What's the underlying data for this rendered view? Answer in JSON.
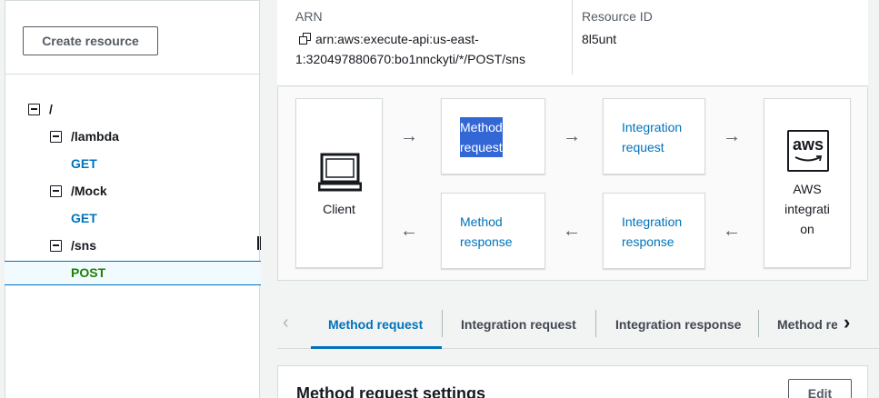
{
  "sidebar": {
    "create_button": "Create resource",
    "tree": [
      {
        "label": "/",
        "kind": "resource"
      },
      {
        "label": "/lambda",
        "kind": "resource"
      },
      {
        "label": "GET",
        "kind": "method"
      },
      {
        "label": "/Mock",
        "kind": "resource"
      },
      {
        "label": "GET",
        "kind": "method"
      },
      {
        "label": "/sns",
        "kind": "resource"
      },
      {
        "label": "POST",
        "kind": "method",
        "selected": true
      }
    ]
  },
  "info": {
    "arn_label": "ARN",
    "arn_line1": "arn:aws:execute-api:us-east-",
    "arn_line2": "1:320497880670:bo1nnckyti/*/POST/sns",
    "resource_id_label": "Resource ID",
    "resource_id_value": "8l5unt"
  },
  "flow": {
    "client": "Client",
    "method_request_1": "Method",
    "method_request_2": "request",
    "integration_request_1": "Integration",
    "integration_request_2": "request",
    "method_response_1": "Method",
    "method_response_2": "response",
    "integration_response_1": "Integration",
    "integration_response_2": "response",
    "aws_logo": "aws",
    "aws_integration_1": "AWS",
    "aws_integration_2": "integrati",
    "aws_integration_3": "on"
  },
  "tabs": {
    "items": [
      "Method request",
      "Integration request",
      "Integration response",
      "Method re"
    ],
    "active": "Method request"
  },
  "settings": {
    "title": "Method request settings",
    "edit": "Edit"
  },
  "colors": {
    "link": "#0073bb",
    "post": "#1d8102",
    "highlight": "#3367d6"
  }
}
